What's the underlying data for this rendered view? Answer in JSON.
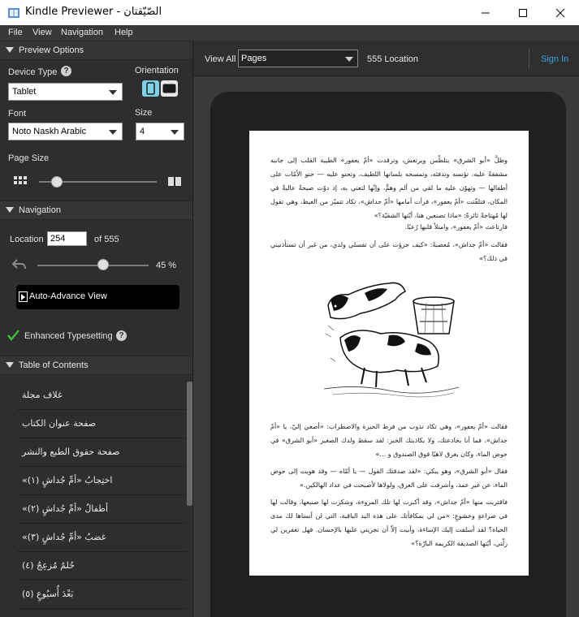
{
  "window": {
    "title": "Kindle Previewer - الصّيّقتان",
    "controls": [
      "—",
      "☐",
      "✕"
    ]
  },
  "menu": [
    "File",
    "View",
    "Navigation",
    "Help"
  ],
  "preview_options": {
    "header": "Preview Options",
    "device_type_label": "Device Type",
    "device_type_value": "Tablet",
    "orientation_label": "Orientation",
    "font_label": "Font",
    "font_value": "Noto Naskh Arabic",
    "size_label": "Size",
    "size_value": "4",
    "page_size_label": "Page Size",
    "page_size_level": 0.15
  },
  "navigation": {
    "header": "Navigation",
    "location_label": "Location",
    "location_value": "254",
    "location_total": "of 555",
    "progress_text": "45 %",
    "progress": 0.45,
    "auto_advance_label": "Auto-Advance View"
  },
  "enhanced_typesetting": {
    "label": "Enhanced Typesetting"
  },
  "toc": {
    "header": "Table of Contents",
    "items": [
      "غلاف مجلة",
      "صفحة عنوان الكتاب",
      "صفحة حقوق الطبع والنشر",
      "«اختِجابُ «أمِّ جُداشٍ (١)",
      "«أطفالُ «أمِّ جُداشٍ (٢)",
      "«غضبُ «أمِّ جُداشٍ (٣)",
      "حُلمٌ مُزعِجٌ (٤)",
      "بَعْدَ أُسبُوعٍ (٥)"
    ]
  },
  "viewer": {
    "view_all_label": "View All",
    "view_mode": "Pages",
    "location_count": "555 Location",
    "sign_in": "Sign In"
  },
  "page_content": {
    "para1": "وظلَّ «أبو الشرق» يتلطّس ويرتعش، وترقدت «أمّ يعفور» الطيبة القلب إلى جانبه مشفقةً عليه، تؤنسه وتدفئه، وتمسحه بلسانها اللطيف، وتحنو عليه — حنو الأمّات على أطفالها — وتهوّن عليه ما لقي من ألم وهمٍّ، وإنّها لتعني به، إذ دوّت صيحةٌ عاليةٌ في المكان، فتلفّتت «أمّ يعفور»، فرأت أمامها «أمّ جداش»، تكاد تتميّز من الغيظ، وهي تقول لها مُهتاجةً ثائرةً: «ماذا تصنعين هنا، أيّتها الشقيّة؟»",
    "para2": "فارتاعت «أمّ يعفور»، وامتلأ قلبها رُعبًا.",
    "para3": "فقالت «أمّ جداش»، مُغضبةً: «كيف جرؤت على أن تفسلي ولدي، من غير أن تستأذنيني في ذلك؟»",
    "para4": "فقالت «أمّ يعفور»، وهي تكاد تذوب من فرط الحيرة والاضطراب: «أصغي إليّ، يا «أمّ جداش»، فما أنا بخادعتك، ولا بكاذبتك الخبر: لقد سقط ولدك الصغير «أبو الشرق» في حوض الماء، وكان يغرق لاهيًا فوق الصندوق و …»",
    "para5": "فقال «أبو الشرق»، وهو يبكي: «لقد صدقتك القول — يا أمّاه — وقد هويت إلى حوض الماء، عن غير عمد، وأشرفت على الغرق، ولولاها لأصبحت في عداد الهالكين.»",
    "para6": "فاقتربت منها «أمّ جداش»، وقد أكبرت لها تلك المروءة، وشكرت لها صنيعها، وقالت لها في ضراعةٍ وخشوعٍ: «من لي بمكافأتك على هذه اليد الباقية، التي لن أنساها لك مدى الحياة؟ لقد أسلفت إليك الإساءة، وأبيت إلاّ أن تجزيني عليها بالإحسان. فهل تغفرين لي زلّتي، أيّتها الصديقة الكريمة البارّة؟»"
  },
  "colors": {
    "accent_link": "#3da0e0",
    "check_green": "#3ec23e",
    "panel_bg": "#2e2e2e",
    "page_bg": "#ffffff"
  }
}
